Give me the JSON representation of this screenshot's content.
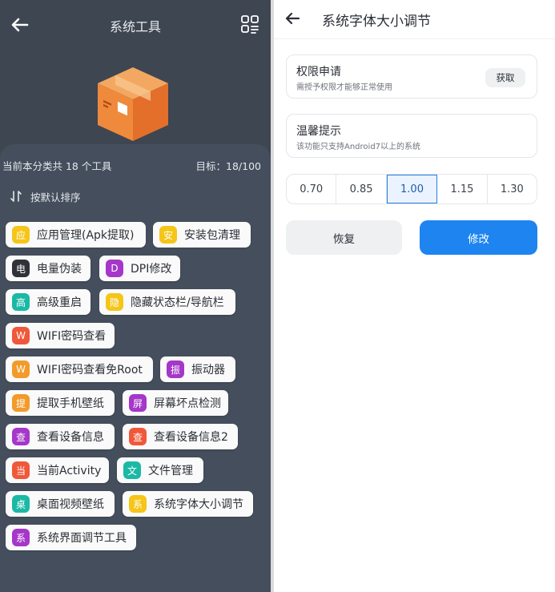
{
  "left": {
    "title": "系统工具",
    "stat_left": "当前本分类共 18 个工具",
    "stat_right": "目标：18/100",
    "sort_label": "按默认排序",
    "tools": [
      {
        "badge": "应",
        "label": "应用管理(Apk提取)",
        "color": "#f5c518"
      },
      {
        "badge": "安",
        "label": "安装包清理",
        "color": "#f5c518"
      },
      {
        "badge": "电",
        "label": "电量伪装",
        "color": "#2f3238"
      },
      {
        "badge": "D",
        "label": "DPI修改",
        "color": "#a537c9"
      },
      {
        "badge": "高",
        "label": "高级重启",
        "color": "#1bb9a5"
      },
      {
        "badge": "隐",
        "label": "隐藏状态栏/导航栏",
        "color": "#f5c518"
      },
      {
        "badge": "W",
        "label": "WIFI密码查看",
        "color": "#f0583a"
      },
      {
        "badge": "W",
        "label": "WIFI密码查看免Root",
        "color": "#f39a2a"
      },
      {
        "badge": "振",
        "label": "振动器",
        "color": "#a537c9"
      },
      {
        "badge": "提",
        "label": "提取手机壁纸",
        "color": "#f39a2a"
      },
      {
        "badge": "屏",
        "label": "屏幕坏点检测",
        "color": "#a537c9"
      },
      {
        "badge": "查",
        "label": "查看设备信息",
        "color": "#a537c9"
      },
      {
        "badge": "查",
        "label": "查看设备信息2",
        "color": "#f0583a"
      },
      {
        "badge": "当",
        "label": "当前Activity",
        "color": "#f0583a"
      },
      {
        "badge": "文",
        "label": "文件管理",
        "color": "#1bb9a5"
      },
      {
        "badge": "桌",
        "label": "桌面视频壁纸",
        "color": "#1bb9a5"
      },
      {
        "badge": "系",
        "label": "系统字体大小调节",
        "color": "#f5c518"
      },
      {
        "badge": "系",
        "label": "系统界面调节工具",
        "color": "#a537c9"
      }
    ]
  },
  "right": {
    "title": "系统字体大小调节",
    "permission_card": {
      "title": "权限申请",
      "subtitle": "需授予权限才能够正常使用",
      "button": "获取"
    },
    "tip_card": {
      "title": "温馨提示",
      "subtitle": "该功能只支持Android7以上的系统"
    },
    "scale_options": [
      "0.70",
      "0.85",
      "1.00",
      "1.15",
      "1.30"
    ],
    "selected_scale": "1.00",
    "restore_button": "恢复",
    "modify_button": "修改",
    "accent_color": "#1d84f0"
  }
}
